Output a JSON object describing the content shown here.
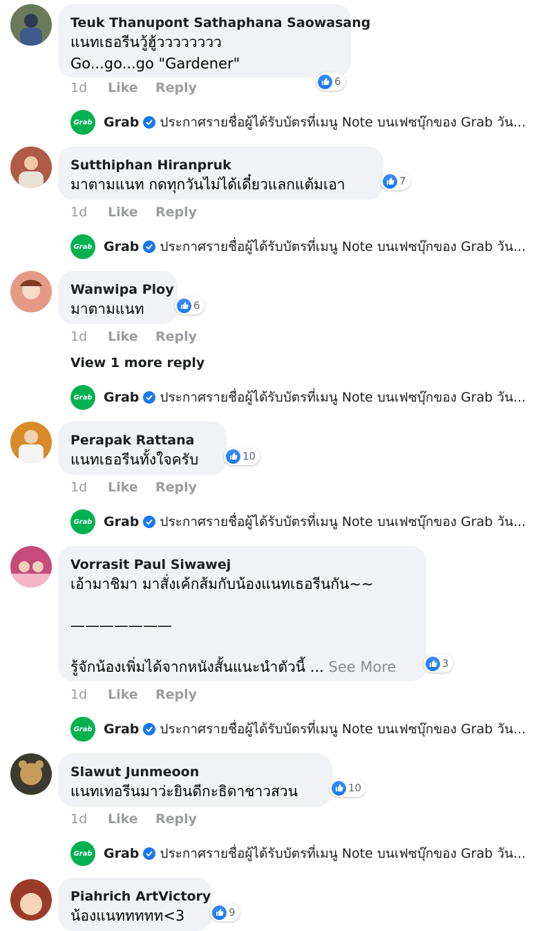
{
  "comments": [
    {
      "name": "Teuk Thanupont Sathaphana Saowasang",
      "lines": [
        "แนทเธอรีนวู้ฮู้วววววววว",
        "Go...go...go  \"Gardener\""
      ],
      "reactions": "6",
      "time": "1d",
      "like": "Like",
      "reply": "Reply",
      "avatar_color": "#6b7a5a"
    },
    {
      "name": "Sutthiphan Hiranpruk",
      "lines": [
        "มาตามแนท กดทุกวันไม่ได้เดี๋ยวแลกแต้มเอา"
      ],
      "reactions": "7",
      "time": "1d",
      "like": "Like",
      "reply": "Reply",
      "avatar_color": "#b05a48"
    },
    {
      "name": "Wanwipa Ploy",
      "lines": [
        "มาตามแนท"
      ],
      "reactions": "6",
      "time": "1d",
      "like": "Like",
      "reply": "Reply",
      "avatar_color": "#e59a88"
    },
    {
      "name": "Perapak Rattana",
      "lines": [
        "แนทเธอรีนทั้งใจครับ"
      ],
      "reactions": "10",
      "time": "1d",
      "like": "Like",
      "reply": "Reply",
      "avatar_color": "#d98a2a"
    },
    {
      "name": "Vorrasit Paul Siwawej",
      "lines": [
        "เอ้ามาชิมา มาสั่งเค้กส้มกับน้องแนทเธอรีนกัน~~",
        "",
        "———————",
        "",
        "รู้จักน้องเพิ่มได้จากหนังสั้นแนะนำตัวนี้ ..."
      ],
      "see_more": "See More",
      "reactions": "3",
      "time": "1d",
      "like": "Like",
      "reply": "Reply",
      "avatar_color": "#c64a7a"
    },
    {
      "name": "Slawut Junmeoon",
      "lines": [
        "แนทเทอรีนมาว่ะยินดีกะธิดาชาวสวน"
      ],
      "reactions": "10",
      "time": "1d",
      "like": "Like",
      "reply": "Reply",
      "avatar_color": "#c79b5a"
    },
    {
      "name": "Piahrich ArtVictory",
      "lines": [
        "น้องแนททททท<3"
      ],
      "reactions": "9",
      "avatar_color": "#9a3b2a"
    }
  ],
  "grab_reply": {
    "logo_text": "Grab",
    "name": "Grab",
    "text": "ประกาศรายชื่อผู้ได้รับบัตรที่เมนู Note บนเฟซบุ๊กของ Grab วัน..."
  },
  "view_more": "View 1 more reply",
  "colors": {
    "like_blue": "#1877f2",
    "grab_green": "#00b14f",
    "bubble": "#f0f2f5"
  }
}
